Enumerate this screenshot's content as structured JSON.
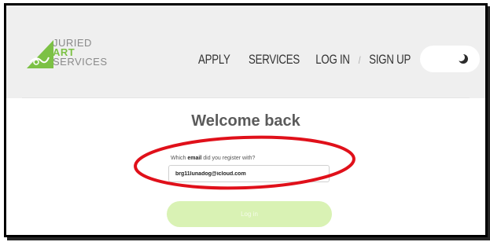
{
  "logo": {
    "line1": "JURIED",
    "line2": "ART",
    "line3": "SERVICES"
  },
  "nav": {
    "apply": "APPLY",
    "services": "SERVICES",
    "login": "LOG IN",
    "separator": "/",
    "signup": "SIGN UP"
  },
  "toggle": {
    "icon": "moon-icon"
  },
  "main": {
    "title": "Welcome back",
    "field_label_pre": "Which ",
    "field_label_bold": "email",
    "field_label_post": " did you register with?",
    "email_value": "brg11lunadog@icloud.com",
    "login_label": "Log in"
  },
  "colors": {
    "brand_green": "#7cc145",
    "button_green_disabled": "#d9f2b4",
    "annotation_red": "#e0101a",
    "header_bg": "#efefef"
  }
}
